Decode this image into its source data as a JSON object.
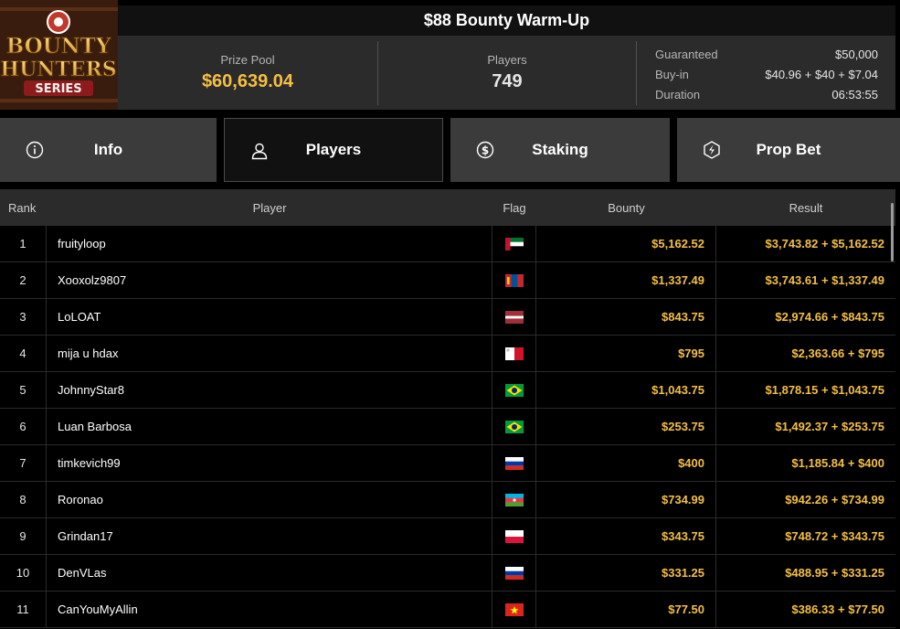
{
  "logo": {
    "line1": "BOUNTY",
    "line2": "HUNTERS",
    "line3": "SERIES"
  },
  "title": "$88 Bounty Warm-Up",
  "prize_pool": {
    "label": "Prize Pool",
    "value": "$60,639.04"
  },
  "players_stat": {
    "label": "Players",
    "value": "749"
  },
  "details": [
    {
      "key": "Guaranteed",
      "value": "$50,000"
    },
    {
      "key": "Buy-in",
      "value": "$40.96 + $40 + $7.04"
    },
    {
      "key": "Duration",
      "value": "06:53:55"
    }
  ],
  "tabs": [
    {
      "label": "Info",
      "icon": "info-icon"
    },
    {
      "label": "Players",
      "icon": "user-icon",
      "active": true
    },
    {
      "label": "Staking",
      "icon": "dollar-circle-icon"
    },
    {
      "label": "Prop Bet",
      "icon": "prop-bet-icon"
    }
  ],
  "table": {
    "headers": [
      "Rank",
      "Player",
      "Flag",
      "Bounty",
      "Result"
    ],
    "rows": [
      {
        "rank": "1",
        "player": "fruityloop",
        "flag": "ae",
        "bounty": "$5,162.52",
        "result": "$3,743.82 + $5,162.52"
      },
      {
        "rank": "2",
        "player": "Xooxolz9807",
        "flag": "mn",
        "bounty": "$1,337.49",
        "result": "$3,743.61 + $1,337.49"
      },
      {
        "rank": "3",
        "player": "LoLOAT",
        "flag": "lv",
        "bounty": "$843.75",
        "result": "$2,974.66 + $843.75"
      },
      {
        "rank": "4",
        "player": "mija u hdax",
        "flag": "mt",
        "bounty": "$795",
        "result": "$2,363.66 + $795"
      },
      {
        "rank": "5",
        "player": "JohnnyStar8",
        "flag": "br",
        "bounty": "$1,043.75",
        "result": "$1,878.15 + $1,043.75"
      },
      {
        "rank": "6",
        "player": "Luan Barbosa",
        "flag": "br",
        "bounty": "$253.75",
        "result": "$1,492.37 + $253.75"
      },
      {
        "rank": "7",
        "player": "timkevich99",
        "flag": "ru",
        "bounty": "$400",
        "result": "$1,185.84 + $400"
      },
      {
        "rank": "8",
        "player": "Roronao",
        "flag": "az",
        "bounty": "$734.99",
        "result": "$942.26 + $734.99"
      },
      {
        "rank": "9",
        "player": "Grindan17",
        "flag": "pl",
        "bounty": "$343.75",
        "result": "$748.72 + $343.75"
      },
      {
        "rank": "10",
        "player": "DenVLas",
        "flag": "ru",
        "bounty": "$331.25",
        "result": "$488.95 + $331.25"
      },
      {
        "rank": "11",
        "player": "CanYouMyAllin",
        "flag": "vn",
        "bounty": "$77.50",
        "result": "$386.33 + $77.50"
      }
    ]
  },
  "colors": {
    "accent": "#f5bf42",
    "panel": "#2b2b2b",
    "tab": "#3b3b3b",
    "background": "#000000"
  }
}
